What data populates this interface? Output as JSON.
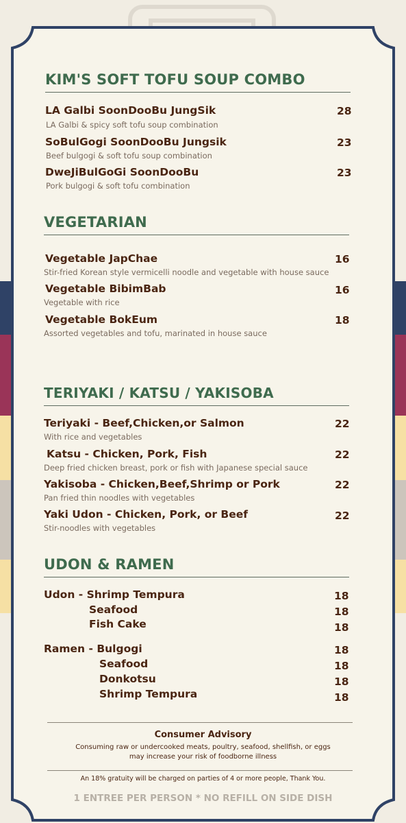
{
  "sections": [
    {
      "title": "KIM'S SOFT TOFU SOUP COMBO",
      "items": [
        {
          "name": "LA Galbi SoonDooBu JungSik",
          "price": "28",
          "desc": "LA Galbi & spicy soft tofu soup combination"
        },
        {
          "name": "SoBulGogi SoonDooBu Jungsik",
          "price": "23",
          "desc": "Beef bulgogi & soft tofu soup combination"
        },
        {
          "name": "DweJiBulGoGi SoonDooBu",
          "price": "23",
          "desc": "Pork bulgogi & soft tofu combination"
        }
      ]
    },
    {
      "title": "VEGETARIAN",
      "items": [
        {
          "name": "Vegetable JapChae",
          "price": "16",
          "desc": "Stir-fried Korean style vermicelli noodle and vegetable with house sauce"
        },
        {
          "name": "Vegetable BibimBab",
          "price": "16",
          "desc": "Vegetable with rice"
        },
        {
          "name": "Vegetable BokEum",
          "price": "18",
          "desc": "Assorted vegetables and tofu, marinated in house sauce"
        }
      ]
    },
    {
      "title": "TERIYAKI / KATSU / YAKISOBA",
      "items": [
        {
          "name": "Teriyaki - Beef,Chicken,or Salmon",
          "price": "22",
          "desc": "With rice and vegetables"
        },
        {
          "name": "Katsu - Chicken, Pork, Fish",
          "price": "22",
          "desc": "Deep fried chicken breast, pork or fish with Japanese special sauce"
        },
        {
          "name": "Yakisoba - Chicken,Beef,Shrimp or Pork",
          "price": "22",
          "desc": "Pan fried thin noodles with vegetables"
        },
        {
          "name": "Yaki Udon - Chicken, Pork, or Beef",
          "price": "22",
          "desc": "Stir-noodles with vegetables"
        }
      ]
    },
    {
      "title": "UDON & RAMEN",
      "items": [
        {
          "name": "Udon - Shrimp Tempura",
          "price": "18"
        },
        {
          "name": "Seafood",
          "price": "18"
        },
        {
          "name": "Fish Cake",
          "price": "18"
        },
        {
          "name": "Ramen - Bulgogi",
          "price": "18"
        },
        {
          "name": "Seafood",
          "price": "18"
        },
        {
          "name": "Donkotsu",
          "price": "18"
        },
        {
          "name": "Shrimp Tempura",
          "price": "18"
        }
      ]
    }
  ],
  "advisory": {
    "title": "Consumer Advisory",
    "line1": "Consuming raw or undercooked meats, poultry, seafood, shellfish, or eggs",
    "line2": "may increase your risk of foodborne illness"
  },
  "gratuity": "An 18% gratuity will be charged on parties of 4 or more people, Thank You.",
  "footer": "1 ENTREE PER PERSON * NO REFILL ON SIDE DISH",
  "colors": {
    "heading": "#3f6b4e",
    "item": "#4a2512",
    "desc": "#7a6a5e",
    "frame": "#2f4266",
    "stripes": [
      "#2f4266",
      "#9a3458",
      "#f6e0a4",
      "#ccc5bc",
      "#f6e0a4"
    ]
  }
}
